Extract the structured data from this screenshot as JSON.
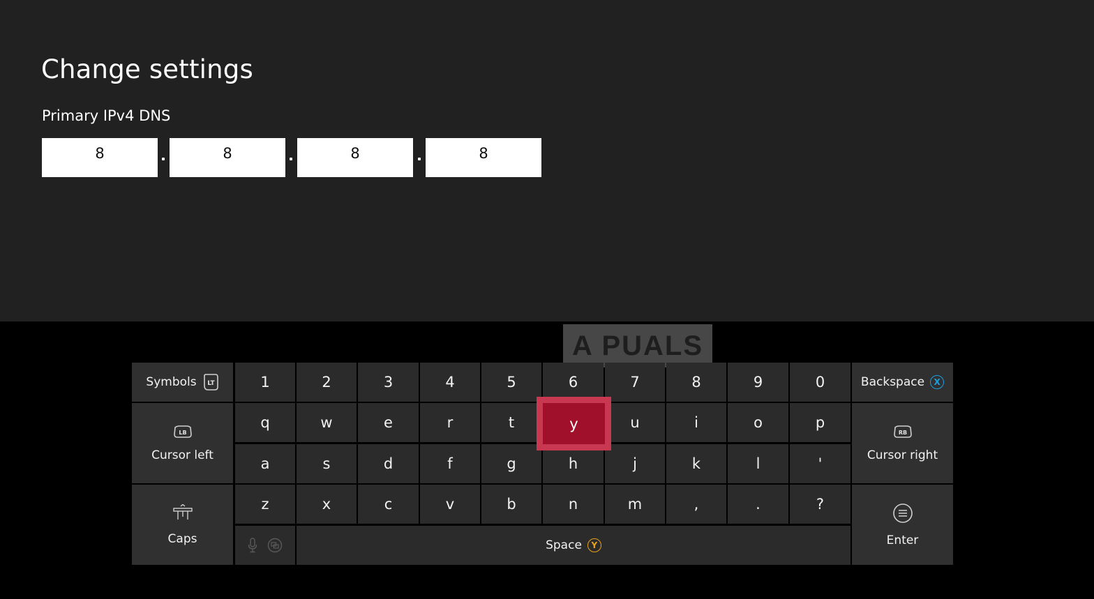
{
  "page": {
    "title": "Change settings"
  },
  "dns": {
    "label": "Primary IPv4 DNS",
    "octets": [
      "8",
      "8",
      "8",
      "8"
    ]
  },
  "keyboard": {
    "symbols_label": "Symbols",
    "symbols_badge": "LT",
    "backspace_label": "Backspace",
    "backspace_badge": "X",
    "cursor_left_label": "Cursor left",
    "cursor_left_badge": "LB",
    "cursor_right_label": "Cursor right",
    "cursor_right_badge": "RB",
    "caps_label": "Caps",
    "enter_label": "Enter",
    "space_label": "Space",
    "space_badge": "Y",
    "number_row": [
      "1",
      "2",
      "3",
      "4",
      "5",
      "6",
      "7",
      "8",
      "9",
      "0"
    ],
    "row_q": [
      "q",
      "w",
      "e",
      "r",
      "t",
      "y",
      "u",
      "i",
      "o",
      "p"
    ],
    "row_a": [
      "a",
      "s",
      "d",
      "f",
      "g",
      "h",
      "j",
      "k",
      "l",
      "'"
    ],
    "row_z": [
      "z",
      "x",
      "c",
      "v",
      "b",
      "n",
      "m",
      ",",
      ".",
      "?"
    ],
    "focused_key": "y"
  },
  "watermark": {
    "text": "A  PUALS"
  },
  "colors": {
    "background_top": "#212121",
    "keyboard_bg": "#000000",
    "key": "#2b2b2b",
    "focus": "#a0102a",
    "badge_x": "#1f9ede",
    "badge_y": "#e8a21a"
  }
}
